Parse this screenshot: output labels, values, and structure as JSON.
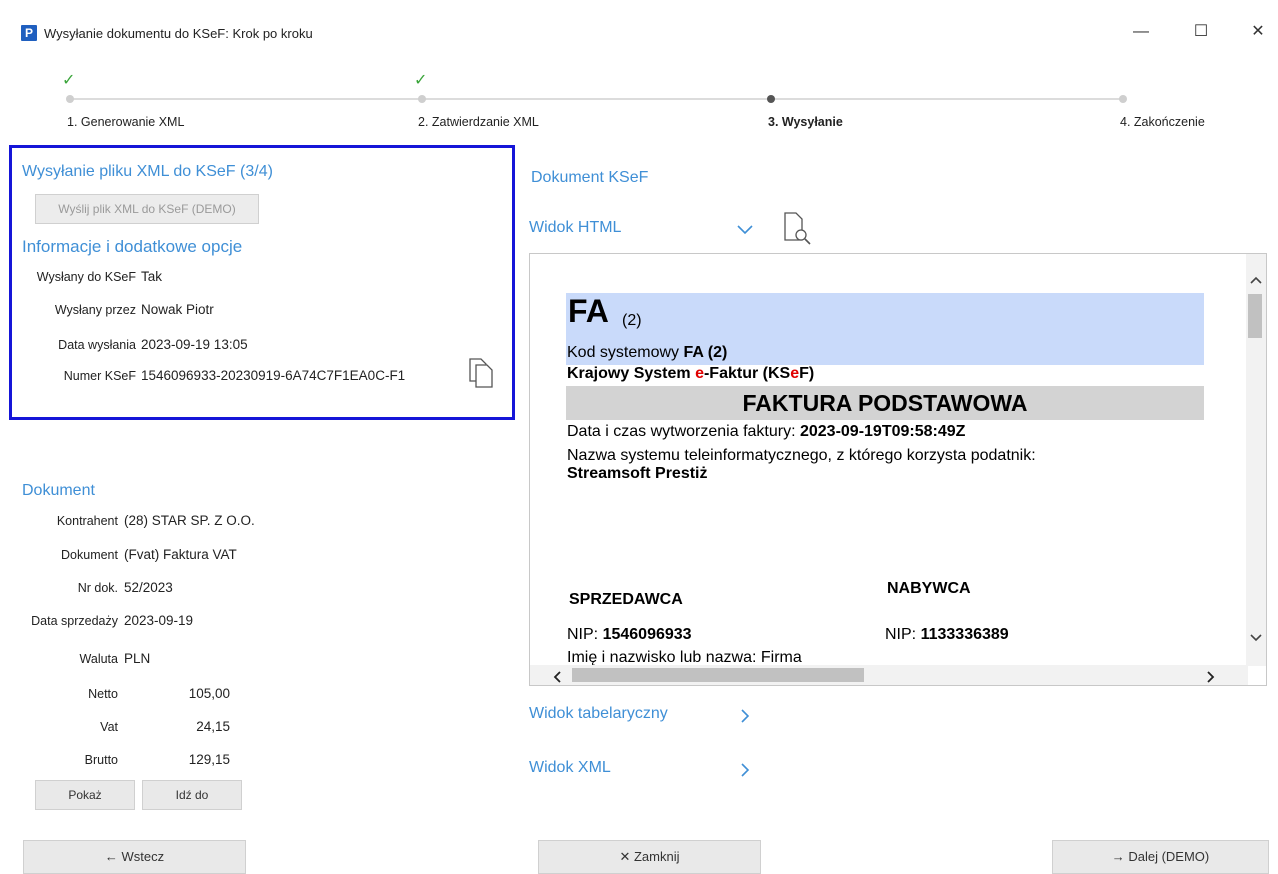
{
  "window": {
    "app_icon_letter": "P",
    "title": "Wysyłanie dokumentu do KSeF: Krok po kroku",
    "minimize_glyph": "—",
    "maximize_glyph": "☐",
    "close_glyph": "✕"
  },
  "steps": [
    {
      "label": "1. Generowanie XML",
      "done": true
    },
    {
      "label": "2. Zatwierdzanie XML",
      "done": true
    },
    {
      "label": "3. Wysyłanie",
      "active": true
    },
    {
      "label": "4. Zakończenie"
    }
  ],
  "send_section": {
    "title": "Wysyłanie pliku XML do KSeF (3/4)",
    "send_button": "Wyślij plik XML do KSeF (DEMO)",
    "info_title": "Informacje i dodatkowe opcje",
    "rows": [
      {
        "label": "Wysłany do KSeF",
        "value": "Tak"
      },
      {
        "label": "Wysłany przez",
        "value": "Nowak Piotr"
      },
      {
        "label": "Data wysłania",
        "value": "2023-09-19 13:05"
      },
      {
        "label": "Numer KSeF",
        "value": "1546096933-20230919-6A74C7F1EA0C-F1"
      }
    ]
  },
  "document_section": {
    "title": "Dokument",
    "rows": [
      {
        "label": "Kontrahent",
        "value": "(28) STAR SP. Z O.O."
      },
      {
        "label": "Dokument",
        "value": "(Fvat) Faktura VAT"
      },
      {
        "label": "Nr dok.",
        "value": "52/2023"
      },
      {
        "label": "Data sprzedaży",
        "value": "2023-09-19"
      },
      {
        "label": "Waluta",
        "value": "PLN"
      },
      {
        "label": "Netto",
        "value": "105,00"
      },
      {
        "label": "Vat",
        "value": "24,15"
      },
      {
        "label": "Brutto",
        "value": "129,15"
      }
    ],
    "show_button": "Pokaż",
    "goto_button": "Idź do"
  },
  "ksef_panel": {
    "title": "Dokument KSeF",
    "html_view": "Widok HTML",
    "table_view": "Widok tabelaryczny",
    "xml_view": "Widok XML"
  },
  "invoice": {
    "fa": "FA",
    "fa_variant": "(2)",
    "system_code_label": "Kod systemowy",
    "system_code_value": "FA (2)",
    "ksef_name_1": "Krajowy System ",
    "ksef_name_e": "e",
    "ksef_name_2": "-Faktur (KS",
    "ksef_name_e2": "e",
    "ksef_name_3": "F)",
    "faktura_title": "FAKTURA PODSTAWOWA",
    "created_label": "Data i czas wytworzenia faktury:",
    "created_value": "2023-09-19T09:58:49Z",
    "system_label": "Nazwa systemu teleinformatycznego, z którego korzysta podatnik:",
    "system_value": "Streamsoft Prestiż",
    "seller": "SPRZEDAWCA",
    "buyer": "NABYWCA",
    "seller_nip_label": "NIP:",
    "seller_nip": "1546096933",
    "buyer_nip_label": "NIP:",
    "buyer_nip": "1133336389",
    "seller_name_partial": "Imię i nazwisko lub nazwa: Firma"
  },
  "footer": {
    "back": "← Wstecz",
    "close": "✕ Zamknij",
    "next": "→ Dalej (DEMO)"
  }
}
